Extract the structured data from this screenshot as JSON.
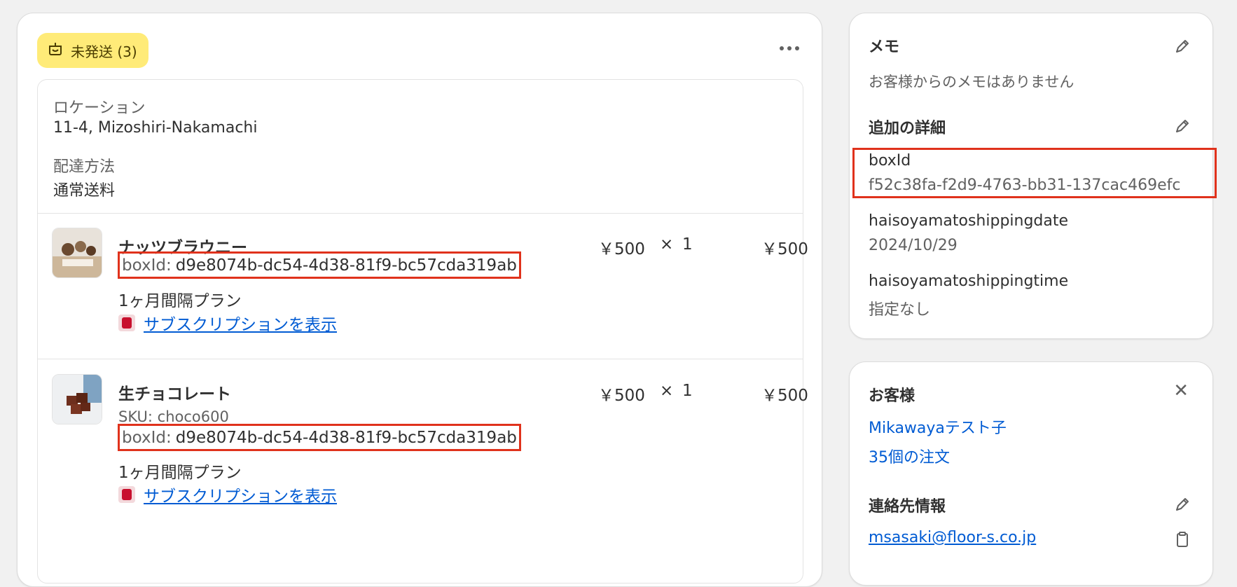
{
  "fulfillment": {
    "badge_label": "未発送 (3)",
    "location_label": "ロケーション",
    "location_value": "11-4, Mizoshiri-Nakamachi",
    "delivery_label": "配達方法",
    "delivery_value": "通常送料"
  },
  "line_items": [
    {
      "name": "ナッツブラウニー",
      "unit_price": "￥500",
      "times": "×",
      "qty": "1",
      "total": "￥500",
      "box_key": "boxId:",
      "box_value": "d9e8074b-dc54-4d38-81f9-bc57cda319ab",
      "plan": "1ヶ月間隔プラン",
      "sub_link": "サブスクリプションを表示"
    },
    {
      "name": "生チョコレート",
      "unit_price": "￥500",
      "times": "×",
      "qty": "1",
      "total": "￥500",
      "sku": "SKU: choco600",
      "box_key": "boxId:",
      "box_value": "d9e8074b-dc54-4d38-81f9-bc57cda319ab",
      "plan": "1ヶ月間隔プラン",
      "sub_link": "サブスクリプションを表示"
    }
  ],
  "memo": {
    "title": "メモ",
    "empty_text": "お客様からのメモはありません",
    "details_title": "追加の詳細",
    "fields": [
      {
        "key": "boxId",
        "value": "f52c38fa-f2d9-4763-bb31-137cac469efc"
      },
      {
        "key": "haisoyamatoshippingdate",
        "value": "2024/10/29"
      },
      {
        "key": "haisoyamatoshippingtime",
        "value": "指定なし"
      }
    ]
  },
  "customer": {
    "title": "お客様",
    "name": "Mikawayaテスト子",
    "orders": "35個の注文",
    "contact_title": "連絡先情報",
    "email": "msasaki@floor-s.co.jp"
  },
  "colors": {
    "highlight": "#e0321c",
    "link": "#005bd3",
    "badge_bg": "#ffeb78"
  },
  "icons": [
    "fulfillment-box-icon",
    "more-icon",
    "edit-icon",
    "close-icon",
    "copy-icon",
    "subscription-app-icon"
  ]
}
